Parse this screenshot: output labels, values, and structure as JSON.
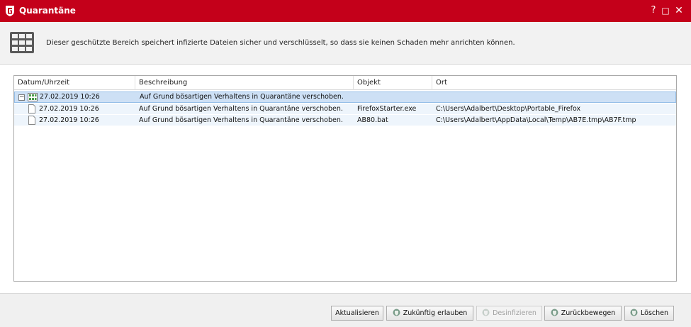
{
  "window": {
    "title": "Quarantäne",
    "controls": {
      "help": "?",
      "maximize": "□",
      "close": "✕"
    }
  },
  "info": {
    "text": "Dieser geschützte Bereich speichert infizierte Dateien sicher und verschlüsselt, so dass sie keinen Schaden mehr anrichten können."
  },
  "table": {
    "columns": [
      "Datum/Uhrzeit",
      "Beschreibung",
      "Objekt",
      "Ort"
    ],
    "group": {
      "expander": "−",
      "datetime": "27.02.2019 10:26",
      "description": "Auf Grund bösartigen Verhaltens in Quarantäne verschoben."
    },
    "rows": [
      {
        "datetime": "27.02.2019 10:26",
        "description": "Auf Grund bösartigen Verhaltens in Quarantäne verschoben.",
        "object": "FirefoxStarter.exe",
        "location": "C:\\Users\\Adalbert\\Desktop\\Portable_Firefox"
      },
      {
        "datetime": "27.02.2019 10:26",
        "description": "Auf Grund bösartigen Verhaltens in Quarantäne verschoben.",
        "object": "AB80.bat",
        "location": "C:\\Users\\Adalbert\\AppData\\Local\\Temp\\AB7E.tmp\\AB7F.tmp"
      }
    ]
  },
  "buttons": {
    "refresh": "Aktualisieren",
    "allow": "Zukünftig erlauben",
    "disinfect": "Desinfizieren",
    "restore": "Zurückbewegen",
    "delete": "Löschen"
  },
  "colors": {
    "titlebar": "#c4001a",
    "selection": "#cde0f5"
  }
}
